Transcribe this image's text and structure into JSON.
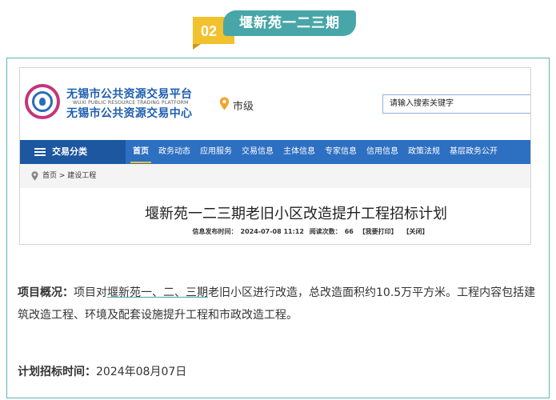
{
  "heading": {
    "number": "02",
    "title": "堰新苑一二三期"
  },
  "website": {
    "org_name_1": "无锡市公共资源交易平台",
    "org_name_en": "WUXI PUBLIC RESOURCE TRADING PLATFORM",
    "org_name_2": "无锡市公共资源交易中心",
    "location": "市级",
    "search_placeholder": "请输入搜索关键字",
    "nav_category": "交易分类",
    "nav_items": [
      "首页",
      "政务动态",
      "应用服务",
      "交易信息",
      "主体信息",
      "专家信息",
      "信用信息",
      "政策法规",
      "基层政务公开"
    ],
    "breadcrumb": "首页 > 建设工程",
    "article_title": "堰新苑一二三期老旧小区改造提升工程招标计划",
    "publish_label": "信息发布时间：",
    "publish_time": "2024-07-08 11:12",
    "views_label": "阅读次数：",
    "views": "66",
    "print_link": "【我要打印】",
    "close_link": "【关闭】"
  },
  "overview": {
    "label": "项目概况：",
    "text_before": "项目对",
    "highlight": "堰新苑一、二、三期",
    "text_after": "老旧小区进行改造，总改造面积约10.5万平方米。工程内容包括建筑改造工程、环境及配套设施提升工程和市政改造工程。"
  },
  "bid_time": {
    "label": "计划招标时间：",
    "value": "2024年08月07日"
  },
  "colors": {
    "accent_teal": "#48a6a8",
    "accent_yellow": "#f2c12e",
    "nav_blue": "#2d6fc1"
  }
}
